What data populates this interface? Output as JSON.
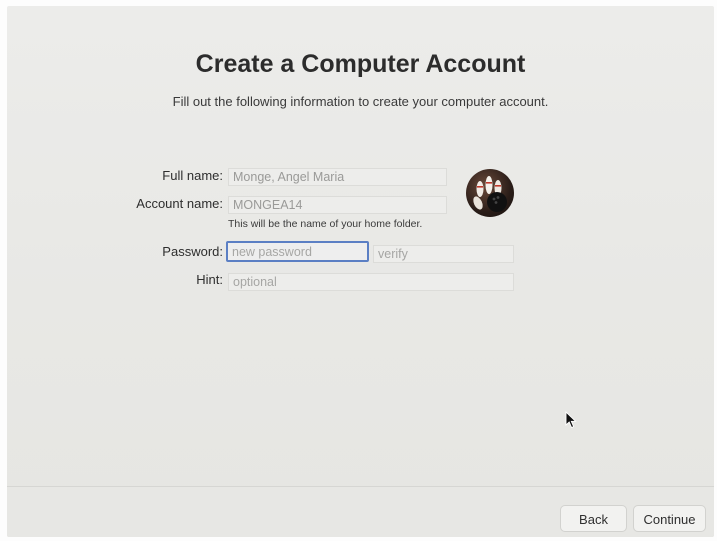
{
  "page": {
    "title": "Create a Computer Account",
    "subtitle": "Fill out the following information to create your computer account."
  },
  "form": {
    "full_name": {
      "label": "Full name:",
      "value": "Monge, Angel Maria"
    },
    "account_name": {
      "label": "Account name:",
      "value": "MONGEA14",
      "note": "This will be the name of your home folder."
    },
    "password": {
      "label": "Password:",
      "placeholder": "new password",
      "verify_placeholder": "verify"
    },
    "hint": {
      "label": "Hint:",
      "placeholder": "optional"
    }
  },
  "avatar": {
    "icon": "bowling-pins-icon"
  },
  "footer": {
    "back_label": "Back",
    "continue_label": "Continue"
  },
  "colors": {
    "focus_ring": "#5b7fc4",
    "background": "#e9e9e6"
  }
}
